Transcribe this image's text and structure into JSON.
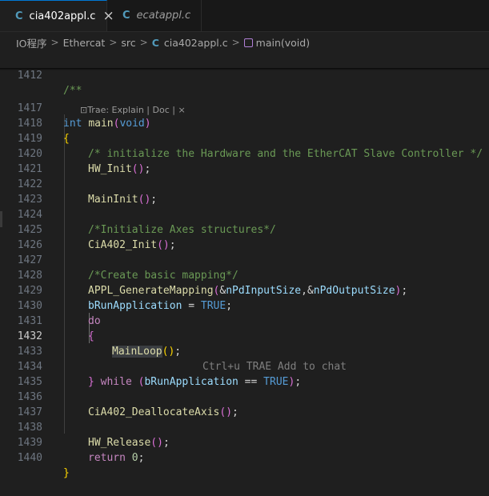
{
  "tabs": [
    {
      "icon": "C",
      "label": "cia402appl.c",
      "close": "×"
    },
    {
      "icon": "C",
      "label": "ecatappl.c"
    }
  ],
  "breadcrumb": {
    "items": [
      "IO程序",
      "Ethercat",
      "src",
      "cia402appl.c",
      "main(void)"
    ],
    "separator": ">",
    "file_icon": "C"
  },
  "codelens": {
    "icon": "⊡",
    "text": "Trae: Explain | Doc | ×"
  },
  "editor": {
    "sticky_line": {
      "number": "1412",
      "text": "/**"
    },
    "lines": [
      {
        "number": "1417",
        "text": "int main(void)"
      },
      {
        "number": "1418",
        "text": "{"
      },
      {
        "number": "1419",
        "text": "/* initialize the Hardware and the EtherCAT Slave Controller */"
      },
      {
        "number": "1420",
        "text": "HW_Init();"
      },
      {
        "number": "1421",
        "text": ""
      },
      {
        "number": "1422",
        "text": "MainInit();"
      },
      {
        "number": "1423",
        "text": ""
      },
      {
        "number": "1424",
        "text": "/*Initialize Axes structures*/"
      },
      {
        "number": "1425",
        "text": "CiA402_Init();"
      },
      {
        "number": "1426",
        "text": ""
      },
      {
        "number": "1427",
        "text": "/*Create basic mapping*/"
      },
      {
        "number": "1428",
        "text": "APPL_GenerateMapping(&nPdInputSize,&nPdOutputSize);"
      },
      {
        "number": "1429",
        "text": "bRunApplication = TRUE;"
      },
      {
        "number": "1430",
        "text": "do"
      },
      {
        "number": "1431",
        "text": "{"
      },
      {
        "number": "1432",
        "text": "MainLoop();"
      },
      {
        "number": "1433",
        "text": ""
      },
      {
        "number": "1434",
        "text": "} while (bRunApplication == TRUE);"
      },
      {
        "number": "1435",
        "text": ""
      },
      {
        "number": "1436",
        "text": "CiA402_DeallocateAxis();"
      },
      {
        "number": "1437",
        "text": ""
      },
      {
        "number": "1438",
        "text": "HW_Release();"
      },
      {
        "number": "1439",
        "text": "return 0;"
      },
      {
        "number": "1440",
        "text": "}"
      }
    ],
    "current_line": "1432",
    "inline_hint": "Ctrl+u TRAE Add to chat"
  },
  "colors": {
    "background": "#1f1f1f",
    "keyword": "#569cd6",
    "control": "#c586c0",
    "function": "#dcdcaa",
    "variable": "#9cdcfe",
    "comment": "#6a9955",
    "accent": "#0078d4"
  }
}
